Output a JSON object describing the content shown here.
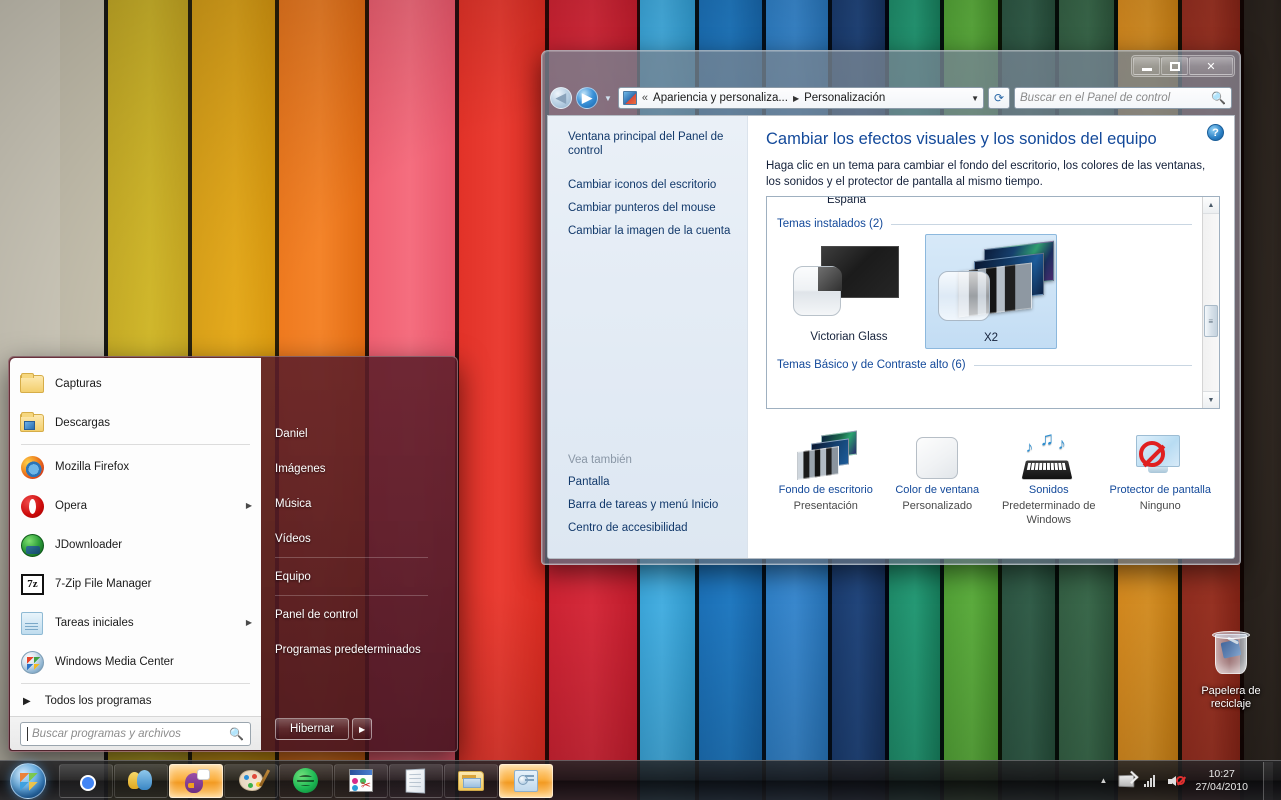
{
  "desktop": {
    "recycle_bin": {
      "label": "Papelera de\nreciclaje",
      "line1": "Papelera de",
      "line2": "reciclaje",
      "icon": "recycle-bin-icon"
    }
  },
  "control_panel_window": {
    "window_buttons": {
      "minimize": "minimize-icon",
      "maximize": "maximize-icon",
      "close": "✕"
    },
    "nav": {
      "back": "◀",
      "forward": "▶",
      "history_dropdown": "▼",
      "address_icon": "personalization-icon",
      "address_chevrons": "«",
      "breadcrumb_1": "Apariencia y personaliza...",
      "breadcrumb_arrow": "▶",
      "breadcrumb_2": "Personalización",
      "address_dropdown": "▼",
      "refresh": "⟳"
    },
    "search": {
      "placeholder": "Buscar en el Panel de control",
      "value": "",
      "icon": "search-icon"
    },
    "sidebar": {
      "home_link": "Ventana principal del Panel de control",
      "links": [
        "Cambiar iconos del escritorio",
        "Cambiar punteros del mouse",
        "Cambiar la imagen de la cuenta"
      ],
      "see_also_title": "Vea también",
      "see_also_links": [
        "Pantalla",
        "Barra de tareas y menú Inicio",
        "Centro de accesibilidad"
      ]
    },
    "main": {
      "help_button": "?",
      "title": "Cambiar los efectos visuales y los sonidos del equipo",
      "description": "Haga clic en un tema para cambiar el fondo del escritorio, los colores de las ventanas, los sonidos y el protector de pantalla al mismo tiempo.",
      "partial_item_above": "España",
      "group_installed": "Temas instalados (2)",
      "group_basic": "Temas Básico y de Contraste alto (6)",
      "themes": [
        {
          "name": "Victorian Glass",
          "selected": false
        },
        {
          "name": "X2",
          "selected": true
        }
      ],
      "scrollbar": {
        "up": "▲",
        "down": "▼",
        "grip": "≡"
      },
      "options": [
        {
          "title": "Fondo de escritorio",
          "subtitle": "Presentación",
          "icon": "desktop-background-icon"
        },
        {
          "title": "Color de ventana",
          "subtitle": "Personalizado",
          "icon": "window-color-icon"
        },
        {
          "title": "Sonidos",
          "subtitle": "Predeterminado de Windows",
          "icon": "sounds-icon"
        },
        {
          "title": "Protector de pantalla",
          "subtitle": "Ninguno",
          "icon": "screensaver-icon"
        }
      ]
    }
  },
  "start_menu": {
    "user": {
      "name": "Daniel",
      "avatar": "user-avatar"
    },
    "programs": [
      {
        "label": "Capturas",
        "icon": "folder-icon",
        "has_submenu": false
      },
      {
        "label": "Descargas",
        "icon": "downloads-folder-icon",
        "has_submenu": false
      },
      {
        "label": "Mozilla Firefox",
        "icon": "firefox-icon",
        "has_submenu": false
      },
      {
        "label": "Opera",
        "icon": "opera-icon",
        "has_submenu": true
      },
      {
        "label": "JDownloader",
        "icon": "jdownloader-icon",
        "has_submenu": false
      },
      {
        "label": "7-Zip File Manager",
        "icon": "sevenzip-icon",
        "has_submenu": false
      },
      {
        "label": "Tareas iniciales",
        "icon": "getting-started-icon",
        "has_submenu": true
      },
      {
        "label": "Windows Media Center",
        "icon": "media-center-icon",
        "has_submenu": false
      }
    ],
    "all_programs": {
      "label": "Todos los programas",
      "arrow": "▶"
    },
    "search": {
      "placeholder": "Buscar programas y archivos",
      "value": "",
      "icon": "search-icon"
    },
    "right_items": [
      "Daniel",
      "Imágenes",
      "Música",
      "Vídeos",
      "Equipo",
      "Panel de control",
      "Programas predeterminados"
    ],
    "shutdown": {
      "label": "Hibernar",
      "arrow": "▶"
    },
    "sevenzip_glyph": "7z"
  },
  "taskbar": {
    "start_button": "start-orb",
    "buttons": [
      {
        "name": "google-chrome",
        "icon": "chrome-icon",
        "active": false
      },
      {
        "name": "windows-live-messenger",
        "icon": "messenger-icon",
        "active": false
      },
      {
        "name": "pidgin",
        "icon": "pidgin-icon",
        "active": true
      },
      {
        "name": "paint",
        "icon": "paint-icon",
        "active": false
      },
      {
        "name": "spotify",
        "icon": "spotify-icon",
        "active": false
      },
      {
        "name": "snipping-tool",
        "icon": "snipping-tool-icon",
        "active": false
      },
      {
        "name": "notepad",
        "icon": "notepad-icon",
        "active": false
      },
      {
        "name": "windows-explorer",
        "icon": "explorer-icon",
        "active": false
      },
      {
        "name": "control-panel",
        "icon": "control-panel-icon",
        "active": true
      }
    ],
    "tray": {
      "expand": "▲",
      "icons": [
        "network-icon",
        "signal-bars-icon",
        "volume-muted-icon"
      ],
      "time": "10:27",
      "date": "27/04/2010"
    }
  }
}
